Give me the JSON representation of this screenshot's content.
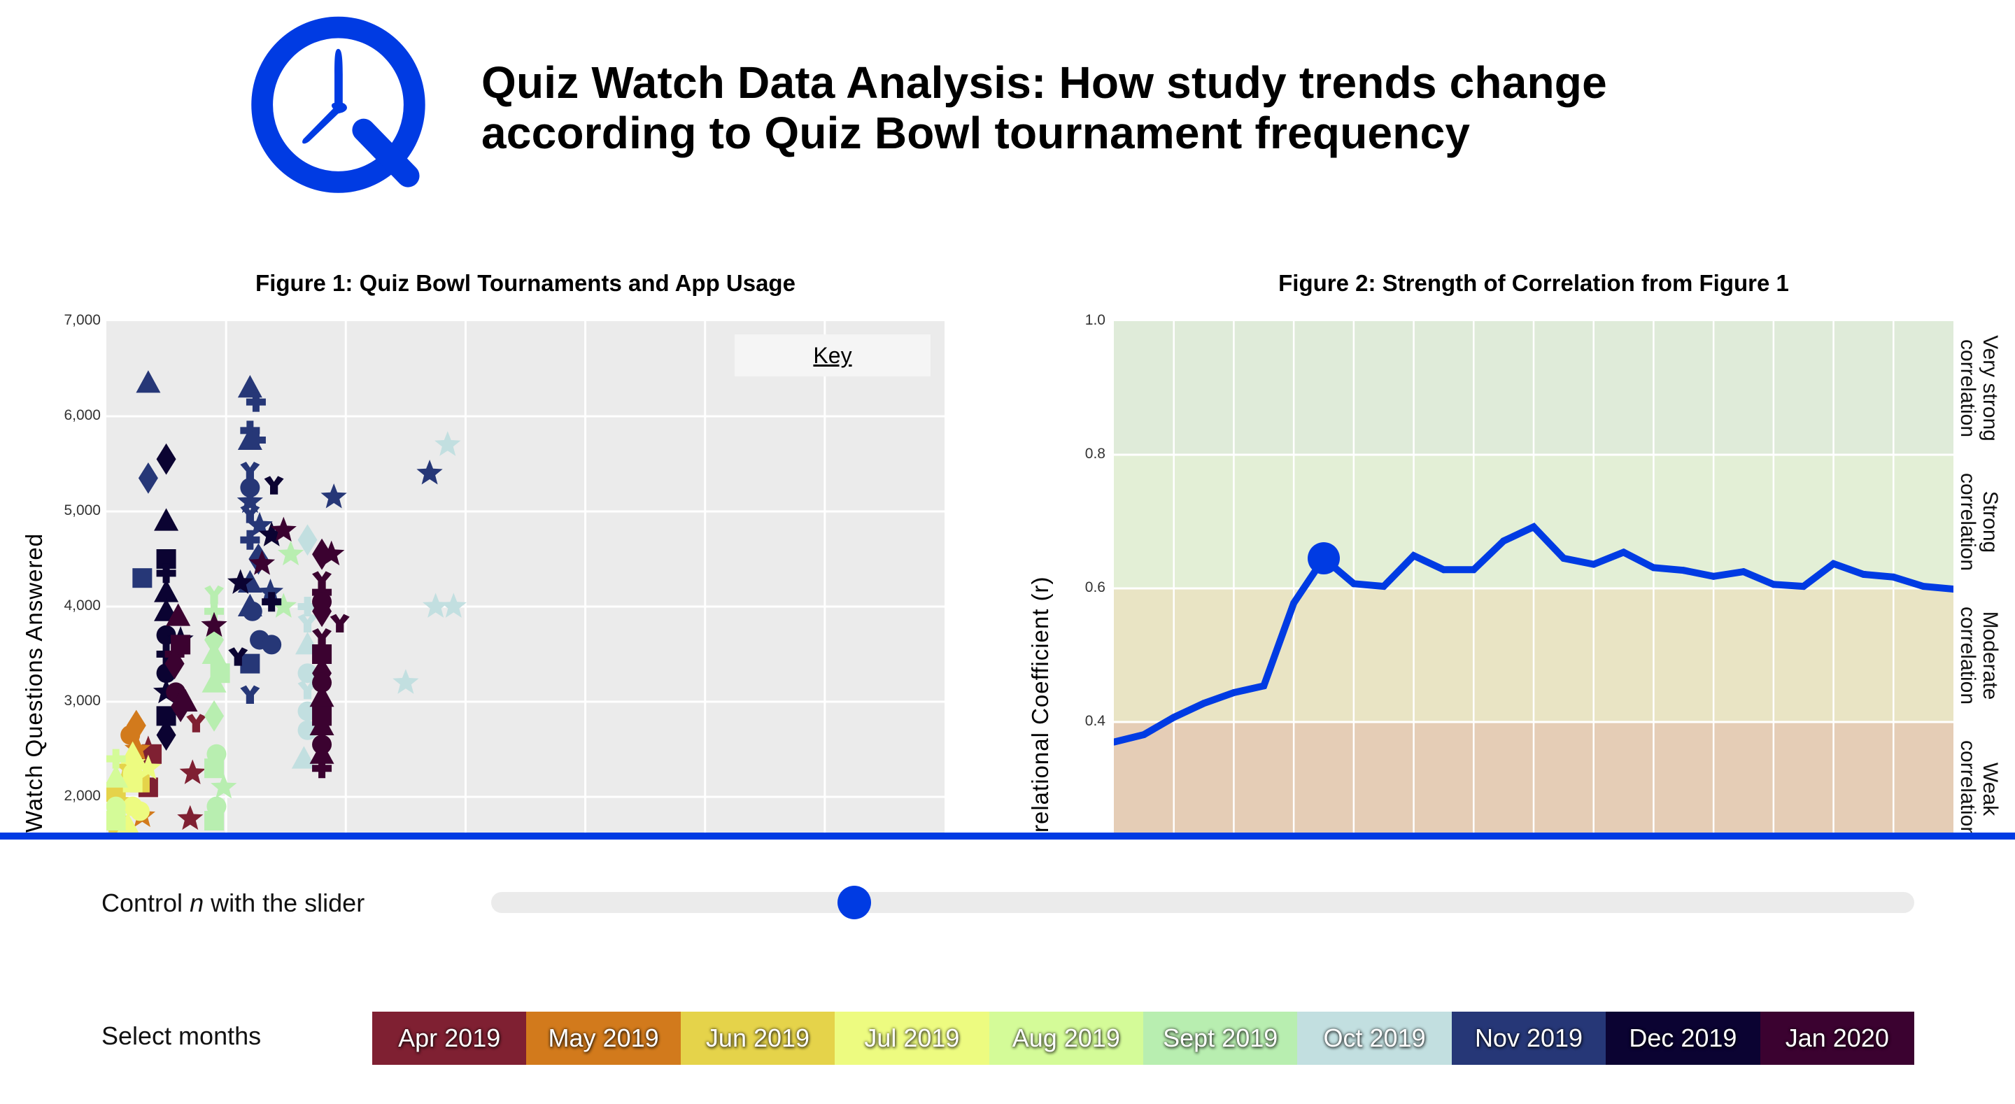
{
  "header": {
    "logo": "quiz-watch-clock-q-logo",
    "title_line1": "Quiz Watch Data Analysis: How study trends change",
    "title_line2": "according to Quiz Bowl tournament frequency"
  },
  "colors": {
    "brand_blue": "#003be3",
    "plot_bg": "#ebebeb",
    "slider_track": "#ebebeb"
  },
  "figure1": {
    "title": "Figure 1: Quiz Bowl Tournaments and App Usage",
    "ylabel": "Quiz Watch Questions Answered",
    "ylabel_visible": "Watch Questions Answered",
    "yticks": [
      "7,000",
      "6,000",
      "5,000",
      "4,000",
      "3,000",
      "2,000"
    ],
    "key_label": "Key"
  },
  "figure2": {
    "title": "Figure 2: Strength of Correlation from Figure 1",
    "ylabel": "Correlational Coefficient (r)",
    "ylabel_visible": "relational Coefficient (r)",
    "yticks": [
      "1.0",
      "0.8",
      "0.6",
      "0.4"
    ],
    "bands": [
      {
        "label_line1": "Very strong",
        "label_line2": "correlation",
        "from": 0.8,
        "to": 1.0,
        "color": "#dfebd9"
      },
      {
        "label_line1": "Strong",
        "label_line2": "correlation",
        "from": 0.6,
        "to": 0.8,
        "color": "#e3efd6"
      },
      {
        "label_line1": "Moderate",
        "label_line2": "correlation",
        "from": 0.4,
        "to": 0.6,
        "color": "#e9e4c4"
      },
      {
        "label_line1": "Weak",
        "label_line2": "correlation",
        "from": 0.2,
        "to": 0.4,
        "color": "#e5cdb6"
      }
    ]
  },
  "controls": {
    "slider_label_prefix": "Control ",
    "slider_label_var": "n",
    "slider_label_suffix": " with the slider",
    "slider_value_fraction": 0.255,
    "months_label": "Select months",
    "months": [
      {
        "label": "Apr 2019",
        "color": "#7f2032"
      },
      {
        "label": "May 2019",
        "color": "#d27a1c"
      },
      {
        "label": "Jun 2019",
        "color": "#e5d34a"
      },
      {
        "label": "Jul 2019",
        "color": "#edfb80"
      },
      {
        "label": "Aug 2019",
        "color": "#d4fb98"
      },
      {
        "label": "Sept 2019",
        "color": "#b8eeb0"
      },
      {
        "label": "Oct 2019",
        "color": "#c2dfe0"
      },
      {
        "label": "Nov 2019",
        "color": "#263777"
      },
      {
        "label": "Dec 2019",
        "color": "#0b0332"
      },
      {
        "label": "Jan 2020",
        "color": "#3b0230"
      }
    ]
  },
  "chart_data": [
    {
      "type": "scatter",
      "title": "Figure 1: Quiz Bowl Tournaments and App Usage",
      "xlabel": "",
      "ylabel": "Quiz Watch Questions Answered",
      "xlim": [
        0,
        7
      ],
      "ylim": [
        1600,
        7000
      ],
      "ytick_values": [
        7000,
        6000,
        5000,
        4000,
        3000,
        2000
      ],
      "grid": true,
      "legend": {
        "title": "Key",
        "placement": "top-right"
      },
      "series": [
        {
          "name": "Apr 2019",
          "color": "#7f2032",
          "points": [
            {
              "x": 0.35,
              "y": 2500,
              "m": "star"
            },
            {
              "x": 0.35,
              "y": 2100,
              "m": "square"
            },
            {
              "x": 0.75,
              "y": 2750,
              "m": "tri_y"
            },
            {
              "x": 0.72,
              "y": 2250,
              "m": "star"
            },
            {
              "x": 0.7,
              "y": 1770,
              "m": "star"
            },
            {
              "x": 0.38,
              "y": 2450,
              "m": "square"
            }
          ]
        },
        {
          "name": "May 2019",
          "color": "#d27a1c",
          "points": [
            {
              "x": 0.2,
              "y": 2650,
              "m": "circle"
            },
            {
              "x": 0.25,
              "y": 2750,
              "m": "diamond"
            },
            {
              "x": 0.3,
              "y": 1800,
              "m": "star"
            },
            {
              "x": 0.26,
              "y": 2500,
              "m": "star"
            }
          ]
        },
        {
          "name": "Jun 2019",
          "color": "#e5d34a",
          "points": [
            {
              "x": 0.08,
              "y": 2050,
              "m": "square"
            },
            {
              "x": 0.12,
              "y": 1950,
              "m": "star"
            },
            {
              "x": 0.18,
              "y": 2300,
              "m": "star"
            },
            {
              "x": 0.28,
              "y": 2150,
              "m": "square"
            },
            {
              "x": 0.1,
              "y": 1700,
              "m": "square"
            }
          ]
        },
        {
          "name": "Jul 2019",
          "color": "#edfb80",
          "points": [
            {
              "x": 0.22,
              "y": 2450,
              "m": "triangle"
            },
            {
              "x": 0.22,
              "y": 2350,
              "m": "star"
            },
            {
              "x": 0.22,
              "y": 2250,
              "m": "circle"
            },
            {
              "x": 0.35,
              "y": 2300,
              "m": "star"
            },
            {
              "x": 0.22,
              "y": 2150,
              "m": "square"
            },
            {
              "x": 0.22,
              "y": 1900,
              "m": "circle"
            },
            {
              "x": 0.28,
              "y": 1850,
              "m": "circle"
            },
            {
              "x": 0.18,
              "y": 1700,
              "m": "triangle"
            }
          ]
        },
        {
          "name": "Aug 2019",
          "color": "#d4fb98",
          "points": [
            {
              "x": 0.08,
              "y": 2400,
              "m": "cross"
            },
            {
              "x": 0.08,
              "y": 2200,
              "m": "triangle"
            },
            {
              "x": 0.08,
              "y": 1900,
              "m": "circle"
            },
            {
              "x": 0.08,
              "y": 1750,
              "m": "square"
            }
          ]
        },
        {
          "name": "Sept 2019",
          "color": "#b8eeb0",
          "points": [
            {
              "x": 0.9,
              "y": 4100,
              "m": "tri_y"
            },
            {
              "x": 0.9,
              "y": 3950,
              "m": "cross"
            },
            {
              "x": 0.9,
              "y": 3650,
              "m": "diamond"
            },
            {
              "x": 0.9,
              "y": 3500,
              "m": "triangle"
            },
            {
              "x": 0.95,
              "y": 3300,
              "m": "square"
            },
            {
              "x": 0.9,
              "y": 3200,
              "m": "triangle"
            },
            {
              "x": 0.9,
              "y": 2850,
              "m": "diamond"
            },
            {
              "x": 0.92,
              "y": 2450,
              "m": "circle"
            },
            {
              "x": 0.9,
              "y": 2300,
              "m": "square"
            },
            {
              "x": 0.98,
              "y": 2100,
              "m": "star"
            },
            {
              "x": 0.92,
              "y": 1900,
              "m": "circle"
            },
            {
              "x": 0.9,
              "y": 1750,
              "m": "square"
            },
            {
              "x": 1.48,
              "y": 4000,
              "m": "star"
            },
            {
              "x": 1.54,
              "y": 4550,
              "m": "star"
            }
          ]
        },
        {
          "name": "Oct 2019",
          "color": "#c2dfe0",
          "points": [
            {
              "x": 1.68,
              "y": 4700,
              "m": "diamond"
            },
            {
              "x": 1.68,
              "y": 4000,
              "m": "cross"
            },
            {
              "x": 1.68,
              "y": 3800,
              "m": "tri_y"
            },
            {
              "x": 1.68,
              "y": 3600,
              "m": "triangle"
            },
            {
              "x": 1.68,
              "y": 3300,
              "m": "circle"
            },
            {
              "x": 1.68,
              "y": 3100,
              "m": "tri_y"
            },
            {
              "x": 1.68,
              "y": 2900,
              "m": "circle"
            },
            {
              "x": 1.68,
              "y": 2700,
              "m": "circle"
            },
            {
              "x": 1.65,
              "y": 2400,
              "m": "triangle"
            },
            {
              "x": 2.5,
              "y": 3200,
              "m": "star"
            },
            {
              "x": 2.75,
              "y": 4000,
              "m": "star"
            },
            {
              "x": 2.9,
              "y": 4000,
              "m": "star"
            },
            {
              "x": 2.85,
              "y": 5700,
              "m": "star"
            }
          ]
        },
        {
          "name": "Nov 2019",
          "color": "#263777",
          "points": [
            {
              "x": 0.35,
              "y": 6350,
              "m": "triangle"
            },
            {
              "x": 0.35,
              "y": 5350,
              "m": "diamond"
            },
            {
              "x": 0.3,
              "y": 4300,
              "m": "square"
            },
            {
              "x": 1.2,
              "y": 6300,
              "m": "triangle"
            },
            {
              "x": 1.25,
              "y": 6150,
              "m": "cross"
            },
            {
              "x": 1.2,
              "y": 5850,
              "m": "cross"
            },
            {
              "x": 1.2,
              "y": 5750,
              "m": "triangle"
            },
            {
              "x": 1.25,
              "y": 5750,
              "m": "cross"
            },
            {
              "x": 1.2,
              "y": 5400,
              "m": "tri_y"
            },
            {
              "x": 1.2,
              "y": 5250,
              "m": "circle"
            },
            {
              "x": 1.2,
              "y": 5100,
              "m": "star"
            },
            {
              "x": 1.2,
              "y": 4950,
              "m": "tri_y"
            },
            {
              "x": 1.28,
              "y": 4850,
              "m": "star"
            },
            {
              "x": 1.2,
              "y": 4700,
              "m": "cross"
            },
            {
              "x": 1.27,
              "y": 4500,
              "m": "diamond"
            },
            {
              "x": 1.2,
              "y": 4250,
              "m": "triangle"
            },
            {
              "x": 1.37,
              "y": 4150,
              "m": "star"
            },
            {
              "x": 1.22,
              "y": 3950,
              "m": "circle"
            },
            {
              "x": 1.28,
              "y": 3650,
              "m": "circle"
            },
            {
              "x": 1.38,
              "y": 3600,
              "m": "circle"
            },
            {
              "x": 1.2,
              "y": 3400,
              "m": "square"
            },
            {
              "x": 1.2,
              "y": 3050,
              "m": "tri_y"
            },
            {
              "x": 1.2,
              "y": 4000,
              "m": "triangle"
            },
            {
              "x": 1.9,
              "y": 5150,
              "m": "star"
            },
            {
              "x": 2.7,
              "y": 5400,
              "m": "star"
            }
          ]
        },
        {
          "name": "Dec 2019",
          "color": "#0b0332",
          "points": [
            {
              "x": 0.5,
              "y": 5550,
              "m": "diamond"
            },
            {
              "x": 0.5,
              "y": 4900,
              "m": "triangle"
            },
            {
              "x": 0.5,
              "y": 4500,
              "m": "square"
            },
            {
              "x": 0.5,
              "y": 4350,
              "m": "cross"
            },
            {
              "x": 0.5,
              "y": 4150,
              "m": "triangle"
            },
            {
              "x": 0.5,
              "y": 3950,
              "m": "triangle"
            },
            {
              "x": 0.5,
              "y": 3700,
              "m": "circle"
            },
            {
              "x": 0.5,
              "y": 3500,
              "m": "cross"
            },
            {
              "x": 0.5,
              "y": 3300,
              "m": "circle"
            },
            {
              "x": 0.5,
              "y": 3100,
              "m": "star"
            },
            {
              "x": 0.5,
              "y": 2850,
              "m": "square"
            },
            {
              "x": 0.5,
              "y": 2650,
              "m": "diamond"
            },
            {
              "x": 0.62,
              "y": 3650,
              "m": "star"
            },
            {
              "x": 1.12,
              "y": 4250,
              "m": "star"
            },
            {
              "x": 1.4,
              "y": 5250,
              "m": "tri_y"
            },
            {
              "x": 1.38,
              "y": 4750,
              "m": "star"
            },
            {
              "x": 1.1,
              "y": 3450,
              "m": "tri_y"
            },
            {
              "x": 1.38,
              "y": 4050,
              "m": "cross"
            }
          ]
        },
        {
          "name": "Jan 2020",
          "color": "#3b0230",
          "points": [
            {
              "x": 0.6,
              "y": 3900,
              "m": "triangle"
            },
            {
              "x": 0.62,
              "y": 3600,
              "m": "square"
            },
            {
              "x": 0.57,
              "y": 3500,
              "m": "cross"
            },
            {
              "x": 0.57,
              "y": 3400,
              "m": "diamond"
            },
            {
              "x": 0.58,
              "y": 3100,
              "m": "circle"
            },
            {
              "x": 0.62,
              "y": 2950,
              "m": "diamond"
            },
            {
              "x": 0.66,
              "y": 3000,
              "m": "triangle"
            },
            {
              "x": 0.9,
              "y": 3800,
              "m": "star"
            },
            {
              "x": 1.3,
              "y": 4450,
              "m": "star"
            },
            {
              "x": 1.48,
              "y": 4800,
              "m": "star"
            },
            {
              "x": 1.8,
              "y": 4550,
              "m": "diamond"
            },
            {
              "x": 1.88,
              "y": 4550,
              "m": "star"
            },
            {
              "x": 1.8,
              "y": 4250,
              "m": "tri_y"
            },
            {
              "x": 1.8,
              "y": 4150,
              "m": "cross"
            },
            {
              "x": 1.8,
              "y": 4050,
              "m": "circle"
            },
            {
              "x": 1.8,
              "y": 3950,
              "m": "diamond"
            },
            {
              "x": 1.95,
              "y": 3800,
              "m": "tri_y"
            },
            {
              "x": 1.8,
              "y": 3650,
              "m": "tri_y"
            },
            {
              "x": 1.8,
              "y": 3500,
              "m": "square"
            },
            {
              "x": 1.8,
              "y": 3300,
              "m": "diamond"
            },
            {
              "x": 1.8,
              "y": 3200,
              "m": "circle"
            },
            {
              "x": 1.8,
              "y": 3050,
              "m": "triangle"
            },
            {
              "x": 1.8,
              "y": 2850,
              "m": "square"
            },
            {
              "x": 1.8,
              "y": 2750,
              "m": "triangle"
            },
            {
              "x": 1.8,
              "y": 2550,
              "m": "circle"
            },
            {
              "x": 1.8,
              "y": 2450,
              "m": "triangle"
            },
            {
              "x": 1.8,
              "y": 2300,
              "m": "cross"
            }
          ]
        }
      ]
    },
    {
      "type": "line",
      "title": "Figure 2: Strength of Correlation from Figure 1",
      "xlabel": "",
      "ylabel": "Correlational Coefficient (r)",
      "xlim": [
        0,
        28
      ],
      "ylim": [
        0.29,
        1.0
      ],
      "ytick_values": [
        1.0,
        0.8,
        0.6,
        0.4
      ],
      "grid": true,
      "x": [
        0,
        1,
        2,
        3,
        4,
        5,
        6,
        7,
        8,
        9,
        10,
        11,
        12,
        13,
        14,
        15,
        16,
        17,
        18,
        19,
        20,
        21,
        22,
        23,
        24,
        25,
        26,
        27,
        28
      ],
      "series": [
        {
          "name": "r",
          "color": "#003be3",
          "values": [
            0.37,
            0.381,
            0.407,
            0.428,
            0.444,
            0.454,
            0.578,
            0.645,
            0.607,
            0.603,
            0.649,
            0.628,
            0.628,
            0.671,
            0.692,
            0.645,
            0.636,
            0.654,
            0.631,
            0.627,
            0.618,
            0.625,
            0.606,
            0.603,
            0.637,
            0.621,
            0.617,
            0.603,
            0.599
          ]
        }
      ],
      "highlighted_point_index": 7,
      "bands": [
        {
          "label": "Very strong correlation",
          "range": [
            0.8,
            1.0
          ]
        },
        {
          "label": "Strong correlation",
          "range": [
            0.6,
            0.8
          ]
        },
        {
          "label": "Moderate correlation",
          "range": [
            0.4,
            0.6
          ]
        },
        {
          "label": "Weak correlation",
          "range": [
            0.2,
            0.4
          ]
        }
      ]
    }
  ]
}
